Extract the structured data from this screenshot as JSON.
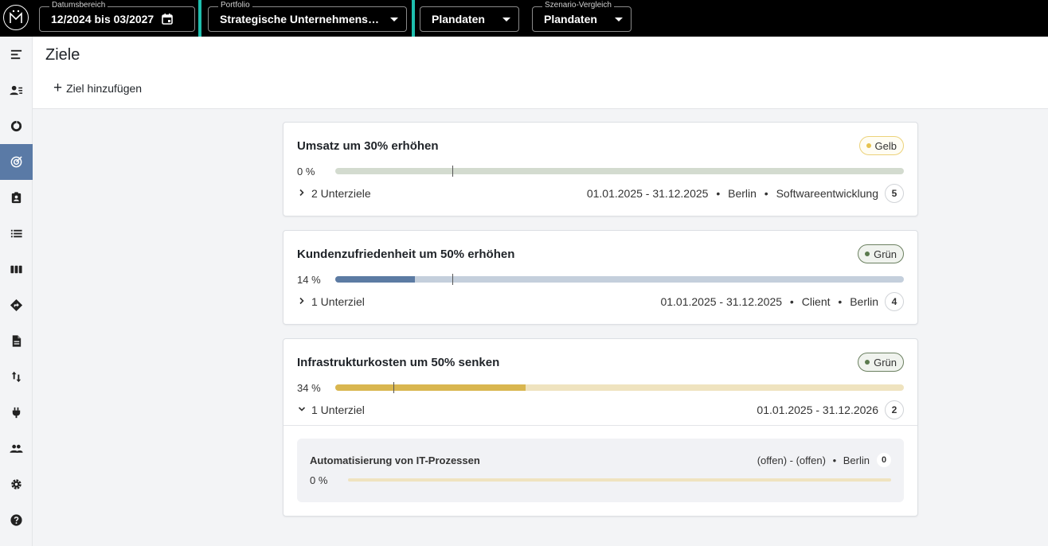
{
  "topbar": {
    "date_range": {
      "legend": "Datumsbereich",
      "value": "12/2024 bis 03/2027"
    },
    "portfolio": {
      "legend": "Portfolio",
      "value": "Strategische Unternehmens…"
    },
    "plandata": {
      "value": "Plandaten"
    },
    "scenario": {
      "legend": "Szenario-Vergleich",
      "value": "Plandaten"
    }
  },
  "sidebar": {
    "items": [
      "menu-collapse-icon",
      "user-list-icon",
      "donut-chart-icon",
      "target-icon",
      "assignment-icon",
      "list-icon",
      "columns-icon",
      "route-sign-icon",
      "document-icon",
      "swap-vertical-icon",
      "plug-icon",
      "people-icon",
      "settings-icon",
      "help-icon"
    ],
    "active_index": 3
  },
  "header": {
    "title": "Ziele",
    "add_label": "Ziel hinzufügen"
  },
  "goals": [
    {
      "title": "Umsatz um 30% erhöhen",
      "status": "Gelb",
      "percent_label": "0 %",
      "progress": 0.0,
      "subgoals_label": "2 Unterziele",
      "expanded": false,
      "date": "01.01.2025 - 31.12.2025",
      "tags": [
        "Berlin",
        "Softwareentwicklung"
      ],
      "count": "5",
      "colors": {
        "track": "#d3dbcf",
        "fill": "#9fb59a"
      }
    },
    {
      "title": "Kundenzufriedenheit um 50% erhöhen",
      "status": "Grün",
      "percent_label": "14 %",
      "progress": 0.14,
      "subgoals_label": "1 Unterziel",
      "expanded": false,
      "date": "01.01.2025 - 31.12.2025",
      "tags": [
        "Client",
        "Berlin"
      ],
      "count": "4",
      "colors": {
        "track": "#c4cfdc",
        "fill": "#5c7ba3"
      }
    },
    {
      "title": "Infrastrukturkosten um 50% senken",
      "status": "Grün",
      "percent_label": "34 %",
      "progress": 0.335,
      "subgoals_label": "1 Unterziel",
      "expanded": true,
      "date": "01.01.2025 - 31.12.2026",
      "tags": [],
      "count": "2",
      "colors": {
        "track": "#efe3bf",
        "fill": "#d9b64f"
      },
      "subgoal": {
        "title": "Automatisierung von IT-Prozessen",
        "date": "(offen) - (offen)",
        "location": "Berlin",
        "count": "0",
        "percent_label": "0 %"
      }
    }
  ]
}
